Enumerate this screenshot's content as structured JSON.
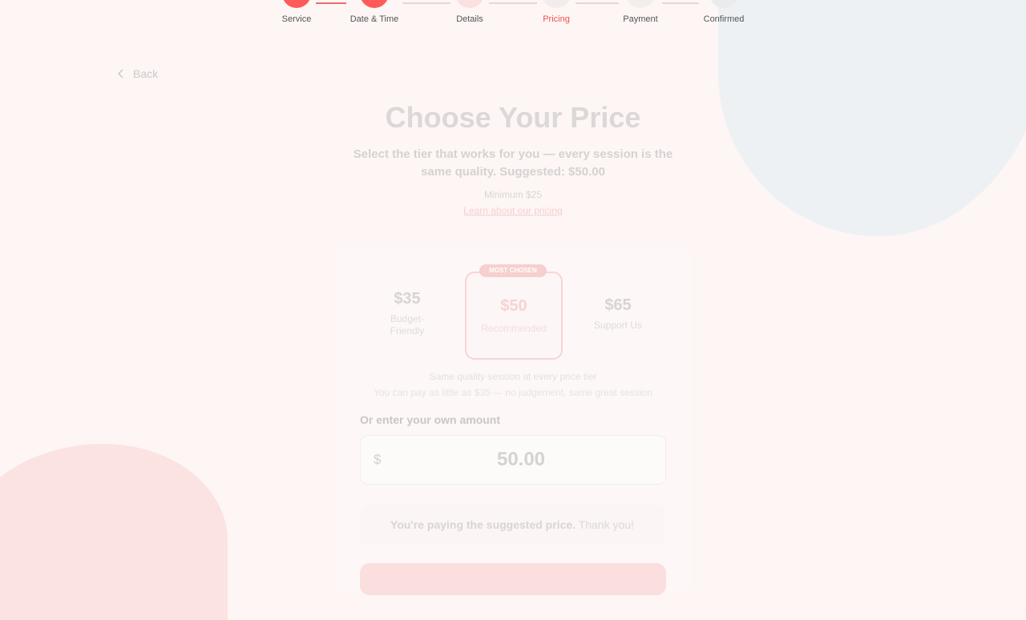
{
  "stepper": {
    "steps": [
      {
        "label": "Service",
        "state": "done"
      },
      {
        "label": "Date & Time",
        "state": "done"
      },
      {
        "label": "Details",
        "state": "done"
      },
      {
        "label": "Pricing",
        "state": "active"
      },
      {
        "label": "Payment",
        "state": "pending"
      },
      {
        "label": "Confirmed",
        "state": "pending"
      }
    ]
  },
  "nav": {
    "back_label": "Back"
  },
  "header": {
    "title": "Choose Your Price",
    "subtitle": "Select the tier that works for you — every session is the same quality. Suggested: $50.00",
    "minimum": "Minimum $25",
    "learn_link": "Learn about our pricing"
  },
  "tiers": [
    {
      "price": "$35",
      "name": "Budget-Friendly"
    },
    {
      "price": "$50",
      "name": "Recommended",
      "badge": "MOST CHOSEN",
      "selected": true
    },
    {
      "price": "$65",
      "name": "Support Us"
    }
  ],
  "notes": {
    "line1": "Same quality session at every price tier",
    "line2": "You can pay as little as $35 — no judgement, same great session"
  },
  "custom": {
    "label": "Or enter your own amount",
    "currency": "$",
    "value": "50.00"
  },
  "status": {
    "bold": "You're paying the suggested price.",
    "normal": "Thank you!"
  },
  "colors": {
    "accent": "#ef6b6b",
    "background": "#fdf6f5"
  }
}
